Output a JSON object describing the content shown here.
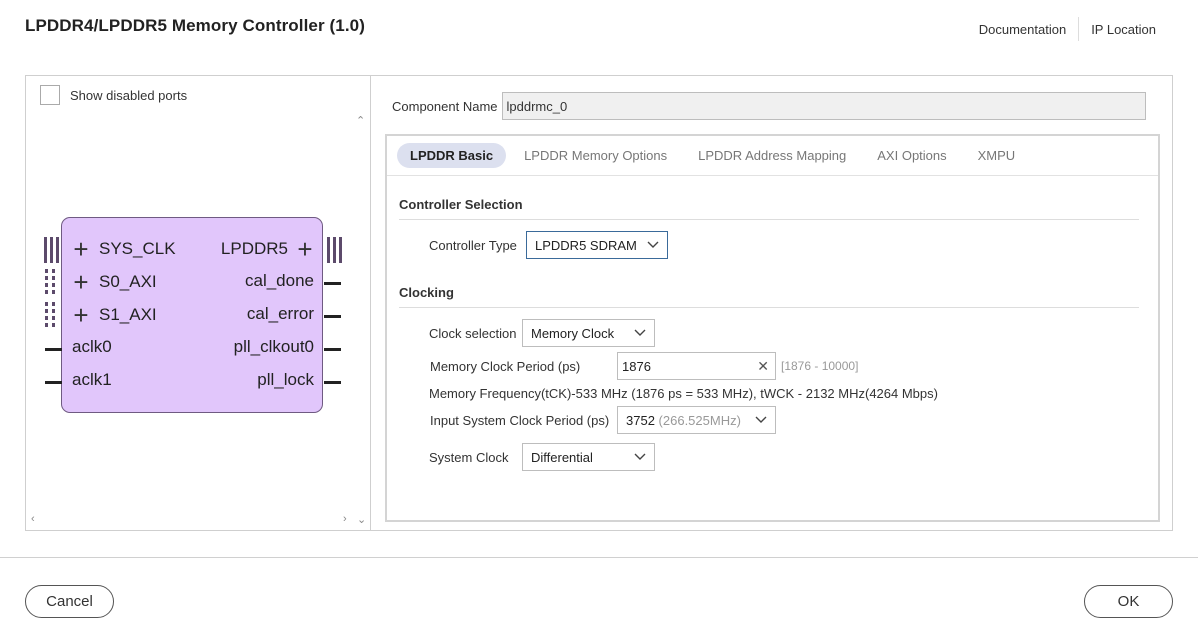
{
  "header": {
    "title": "LPDDR4/LPDDR5  Memory Controller (1.0)",
    "links": [
      "Documentation",
      "IP Location"
    ]
  },
  "left_pane": {
    "show_disabled_ports_label": "Show disabled ports",
    "show_disabled_ports_checked": false,
    "block": {
      "left_ports": [
        "SYS_CLK",
        "S0_AXI",
        "S1_AXI",
        "aclk0",
        "aclk1"
      ],
      "right_ports": [
        "LPDDR5",
        "cal_done",
        "cal_error",
        "pll_clkout0",
        "pll_lock"
      ]
    }
  },
  "right_pane": {
    "component_name_label": "Component Name",
    "component_name_value": "lpddrmc_0",
    "tabs": [
      "LPDDR Basic",
      "LPDDR Memory Options",
      "LPDDR Address Mapping",
      "AXI Options",
      "XMPU"
    ],
    "active_tab": "LPDDR Basic",
    "controller_selection": {
      "heading": "Controller Selection",
      "controller_type_label": "Controller Type",
      "controller_type_value": "LPDDR5 SDRAM"
    },
    "clocking": {
      "heading": "Clocking",
      "clock_selection_label": "Clock selection",
      "clock_selection_value": "Memory Clock",
      "mem_clock_period_label": "Memory Clock Period (ps)",
      "mem_clock_period_value": "1876",
      "mem_clock_period_range": "[1876 - 10000]",
      "mem_frequency_info": "Memory Frequency(tCK)-533 MHz (1876 ps = 533 MHz), tWCK - 2132 MHz(4264 Mbps)",
      "input_sys_clock_label": "Input System Clock Period (ps)",
      "input_sys_clock_value": "3752",
      "input_sys_clock_freq": "(266.525MHz)",
      "system_clock_label": "System Clock",
      "system_clock_value": "Differential"
    }
  },
  "footer": {
    "cancel_label": "Cancel",
    "ok_label": "OK"
  }
}
